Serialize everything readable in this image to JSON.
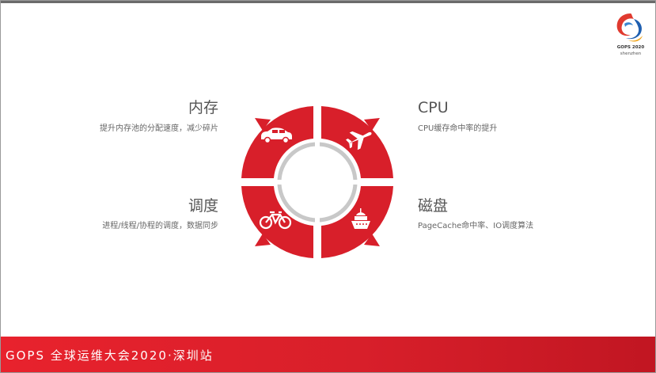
{
  "brand": {
    "logo_line1": "GOPS 2020",
    "logo_line2": "shenzhen"
  },
  "quadrants": {
    "memory": {
      "title": "内存",
      "description": "提升内存池的分配速度，减少碎片",
      "icon": "car-icon"
    },
    "cpu": {
      "title": "CPU",
      "description": "CPU缓存命中率的提升",
      "icon": "airplane-icon"
    },
    "scheduling": {
      "title": "调度",
      "description": "进程/线程/协程的调度，数据同步",
      "icon": "bicycle-icon"
    },
    "disk": {
      "title": "磁盘",
      "description": "PageCache命中率、IO调度算法",
      "icon": "ship-icon"
    }
  },
  "footer": {
    "text": "GOPS 全球运维大会2020·深圳站"
  },
  "colors": {
    "accent": "#d81f2a",
    "ring": "#c8c8c8",
    "text_title": "#555555",
    "text_desc": "#666666"
  }
}
